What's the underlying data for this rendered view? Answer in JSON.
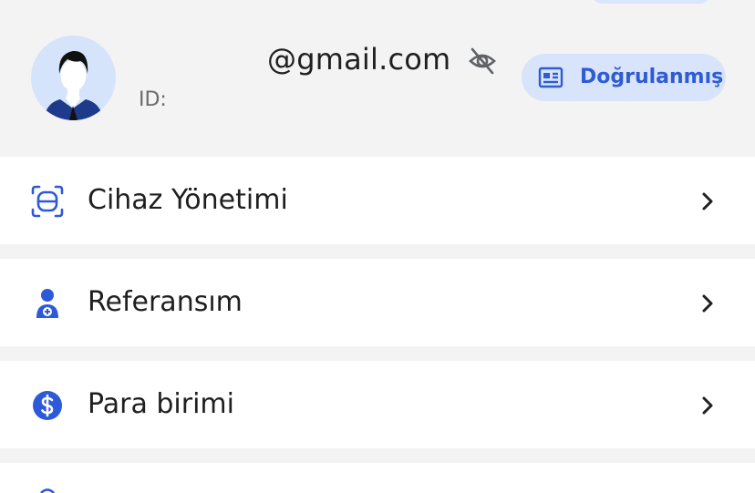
{
  "profile": {
    "email": "@gmail.com",
    "id_label": "ID:",
    "verified_label": "Doğrulanmış"
  },
  "menu": {
    "items": [
      {
        "label": "Cihaz Yönetimi",
        "icon": "device-management-icon"
      },
      {
        "label": "Referansım",
        "icon": "referral-user-add-icon"
      },
      {
        "label": "Para birimi",
        "icon": "dollar-coin-icon"
      }
    ]
  },
  "colors": {
    "accent": "#2f5bd3",
    "icon_blue": "#2d5ad8",
    "badge_bg": "#d7e4fb",
    "page_bg": "#f3f3f3",
    "card_bg": "#ffffff",
    "text": "#1f1f1f",
    "muted": "#6a6a6a"
  }
}
